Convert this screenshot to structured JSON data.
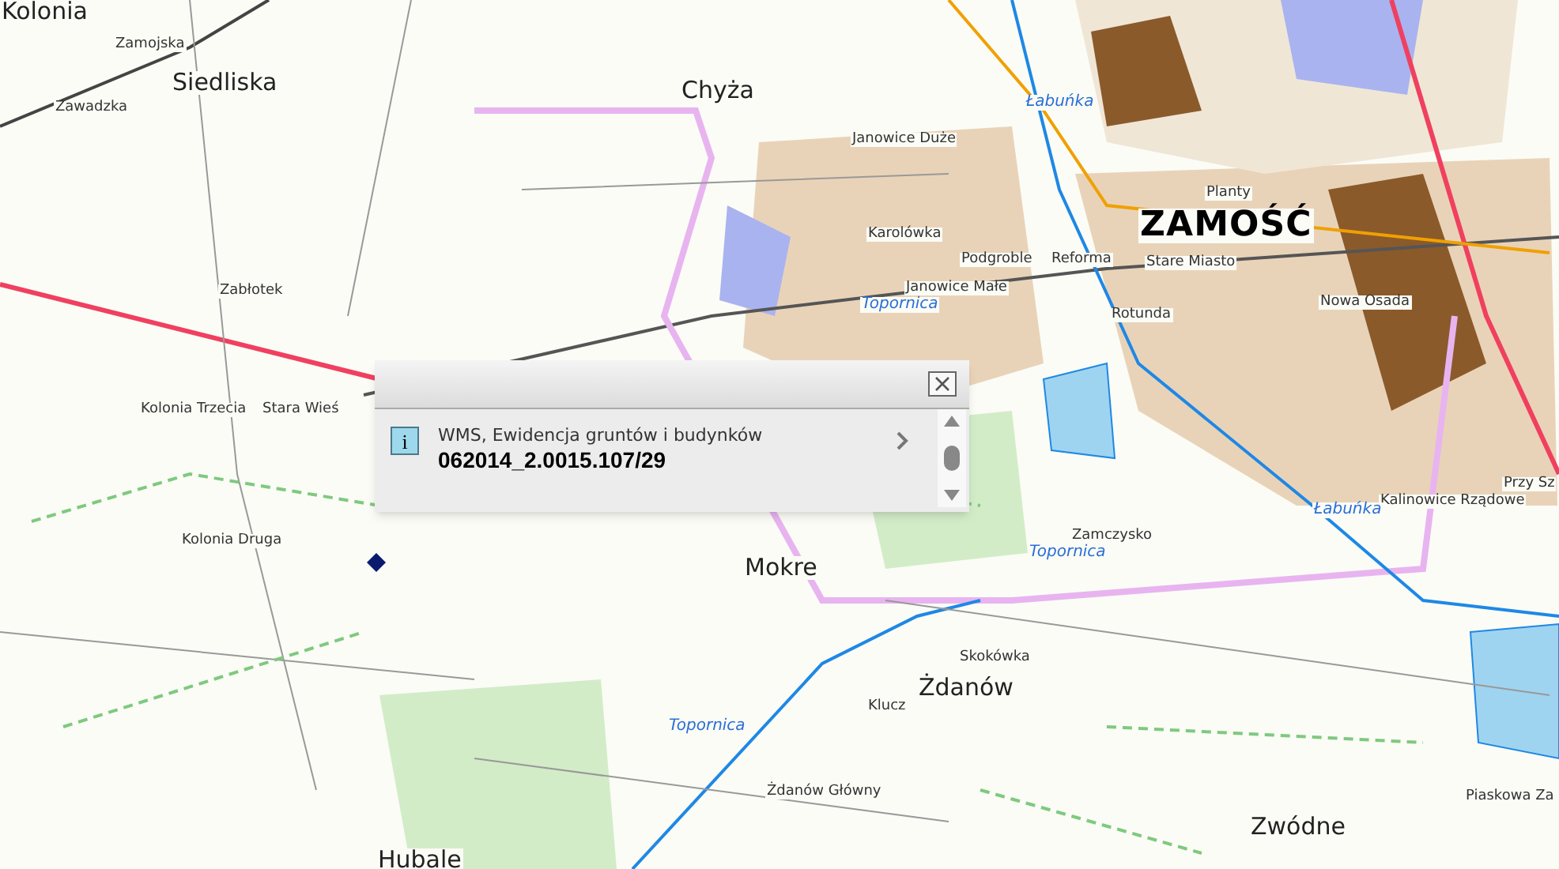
{
  "map": {
    "labels": [
      {
        "text": "ZAMOŚĆ",
        "kind": "city"
      },
      {
        "text": "Chyża",
        "kind": "town"
      },
      {
        "text": "Siedliska",
        "kind": "town"
      },
      {
        "text": "Mokre",
        "kind": "town"
      },
      {
        "text": "Żdanów",
        "kind": "town"
      },
      {
        "text": "Zwódne",
        "kind": "town"
      },
      {
        "text": "Hubale",
        "kind": "town"
      },
      {
        "text": "Kolonia",
        "kind": "town"
      },
      {
        "text": "Janowice Duże",
        "kind": "village"
      },
      {
        "text": "Karolówka",
        "kind": "village"
      },
      {
        "text": "Podgroble",
        "kind": "village"
      },
      {
        "text": "Reforma",
        "kind": "village"
      },
      {
        "text": "Stare Miasto",
        "kind": "village"
      },
      {
        "text": "Planty",
        "kind": "village"
      },
      {
        "text": "Nowa Osada",
        "kind": "village"
      },
      {
        "text": "Janowice Małe",
        "kind": "village"
      },
      {
        "text": "Rotunda",
        "kind": "village"
      },
      {
        "text": "Zamczysko",
        "kind": "village"
      },
      {
        "text": "Skokówka",
        "kind": "village"
      },
      {
        "text": "Klucz",
        "kind": "village"
      },
      {
        "text": "Żdanów Główny",
        "kind": "village"
      },
      {
        "text": "Kolonia Trzecia",
        "kind": "village"
      },
      {
        "text": "Stara Wieś",
        "kind": "village"
      },
      {
        "text": "Kolonia Druga",
        "kind": "village"
      },
      {
        "text": "Zawadzka",
        "kind": "village"
      },
      {
        "text": "Zamojska",
        "kind": "village"
      },
      {
        "text": "Zabłotek",
        "kind": "village"
      },
      {
        "text": "Kalinowice Rządowe",
        "kind": "village"
      },
      {
        "text": "Przy Sz",
        "kind": "village"
      },
      {
        "text": "Piaskowa Za",
        "kind": "village"
      },
      {
        "text": "Łabuńka",
        "kind": "river"
      },
      {
        "text": "Łabuńka",
        "kind": "river"
      },
      {
        "text": "Topornica",
        "kind": "river"
      },
      {
        "text": "Topornica",
        "kind": "river"
      },
      {
        "text": "Topornica",
        "kind": "river"
      }
    ]
  },
  "popup": {
    "icon_text": "i",
    "layer": "WMS, Ewidencja gruntów i budynków",
    "value": "062014_2.0015.107/29"
  }
}
